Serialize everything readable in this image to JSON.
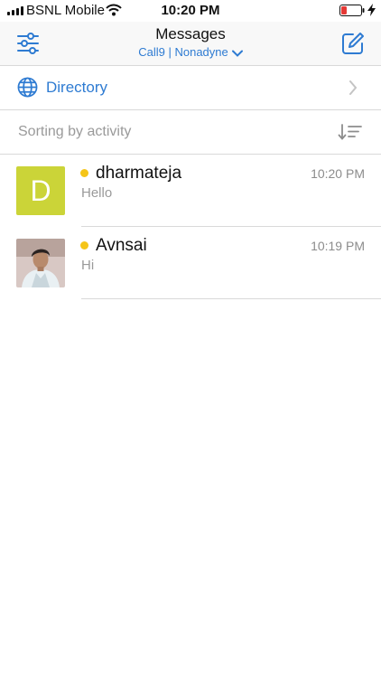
{
  "status_bar": {
    "carrier": "BSNL Mobile",
    "time": "10:20 PM"
  },
  "nav": {
    "title": "Messages",
    "subtitle": "Call9 | Nonadyne"
  },
  "directory": {
    "label": "Directory"
  },
  "sorting": {
    "label": "Sorting by activity"
  },
  "conversations": [
    {
      "name": "dharmateja",
      "initial": "D",
      "message": "Hello",
      "time": "10:20 PM",
      "presence_color": "#f5c518",
      "avatar_color": "#cbd438"
    },
    {
      "name": "Avnsai",
      "message": "Hi",
      "time": "10:19 PM",
      "presence_color": "#f5c518"
    }
  ],
  "colors": {
    "accent": "#2e7bd2",
    "presence": "#f5c518",
    "battery_low": "#e53935"
  }
}
